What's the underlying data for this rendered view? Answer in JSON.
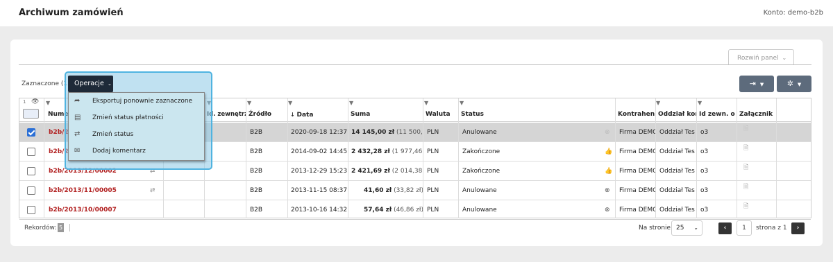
{
  "header": {
    "title": "Archiwum zamówień",
    "account": "Konto: demo-b2b"
  },
  "panel": {
    "expand_label": "Rozwiń panel"
  },
  "toolbar": {
    "selected_label": "Zaznaczone (1)",
    "operations_label": "Operacje"
  },
  "operations_menu": {
    "items": [
      {
        "label": "Eksportuj ponownie zaznaczone",
        "icon": "export-icon"
      },
      {
        "label": "Zmień status płatności",
        "icon": "payment-icon"
      },
      {
        "label": "Zmień status",
        "icon": "refresh-icon"
      },
      {
        "label": "Dodaj komentarz",
        "icon": "comment-icon"
      }
    ]
  },
  "grid": {
    "header_top_count": "1",
    "columns": {
      "number": "Numer",
      "ext_id": "Id. zewnętrz",
      "source": "Źródło",
      "date": "Data",
      "sum": "Suma",
      "currency": "Waluta",
      "status": "Status",
      "contractor": "Kontrahent",
      "branch": "Oddział kont",
      "ext_id2": "Id zewn. odd",
      "attachment": "Załącznik"
    },
    "rows": [
      {
        "selected": true,
        "number": "b2b/20",
        "source": "B2B",
        "date": "2020-09-18 12:37",
        "sum": "14 145,00 zł",
        "net": "(11 500,00",
        "currency": "PLN",
        "status": "Anulowane",
        "status_icon": "cancel-icon",
        "contractor": "Firma DEMO",
        "branch": "Oddział Tes",
        "ext_id2": "o3",
        "attachment": "file-icon"
      },
      {
        "selected": false,
        "number": "b2b/20",
        "source": "B2B",
        "date": "2014-09-02 14:45",
        "sum": "2 432,28 zł",
        "net": "(1 977,46 zł)",
        "currency": "PLN",
        "status": "Zakończone",
        "status_icon": "thumb-up-icon",
        "contractor": "Firma DEMO",
        "branch": "Oddział Tes",
        "ext_id2": "o3",
        "attachment": "file-icon"
      },
      {
        "selected": false,
        "number": "b2b/2013/12/00002",
        "source": "B2B",
        "date": "2013-12-29 15:23",
        "sum": "2 421,69 zł",
        "net": "(2 014,38 zł)",
        "currency": "PLN",
        "status": "Zakończone",
        "status_icon": "thumb-up-icon",
        "contractor": "Firma DEMO",
        "branch": "Oddział Tes",
        "ext_id2": "o3",
        "attachment": "file-icon"
      },
      {
        "selected": false,
        "number": "b2b/2013/11/00005",
        "source": "B2B",
        "date": "2013-11-15 08:37",
        "sum": "41,60 zł",
        "net": "(33,82 zł)",
        "currency": "PLN",
        "status": "Anulowane",
        "status_icon": "cancel-icon",
        "contractor": "Firma DEMO",
        "branch": "Oddział Tes",
        "ext_id2": "o3",
        "attachment": "file-icon"
      },
      {
        "selected": false,
        "number": "b2b/2013/10/00007",
        "source": "B2B",
        "date": "2013-10-16 14:32",
        "sum": "57,64 zł",
        "net": "(46,86 zł)",
        "currency": "PLN",
        "status": "Anulowane",
        "status_icon": "cancel-icon",
        "contractor": "Firma DEMO",
        "branch": "Oddział Tes",
        "ext_id2": "o3",
        "attachment": "file-icon"
      }
    ]
  },
  "footer": {
    "records_label": "Rekordów:",
    "records_count": "5",
    "per_page_label": "Na stronie",
    "per_page_value": "25",
    "current_page": "1",
    "page_of": "strona z 1"
  },
  "colors": {
    "accent": "#2a6fd6",
    "order_link": "#b22222",
    "toolbar_btn": "#5d6b7c",
    "highlight": "#4fb3e0"
  }
}
